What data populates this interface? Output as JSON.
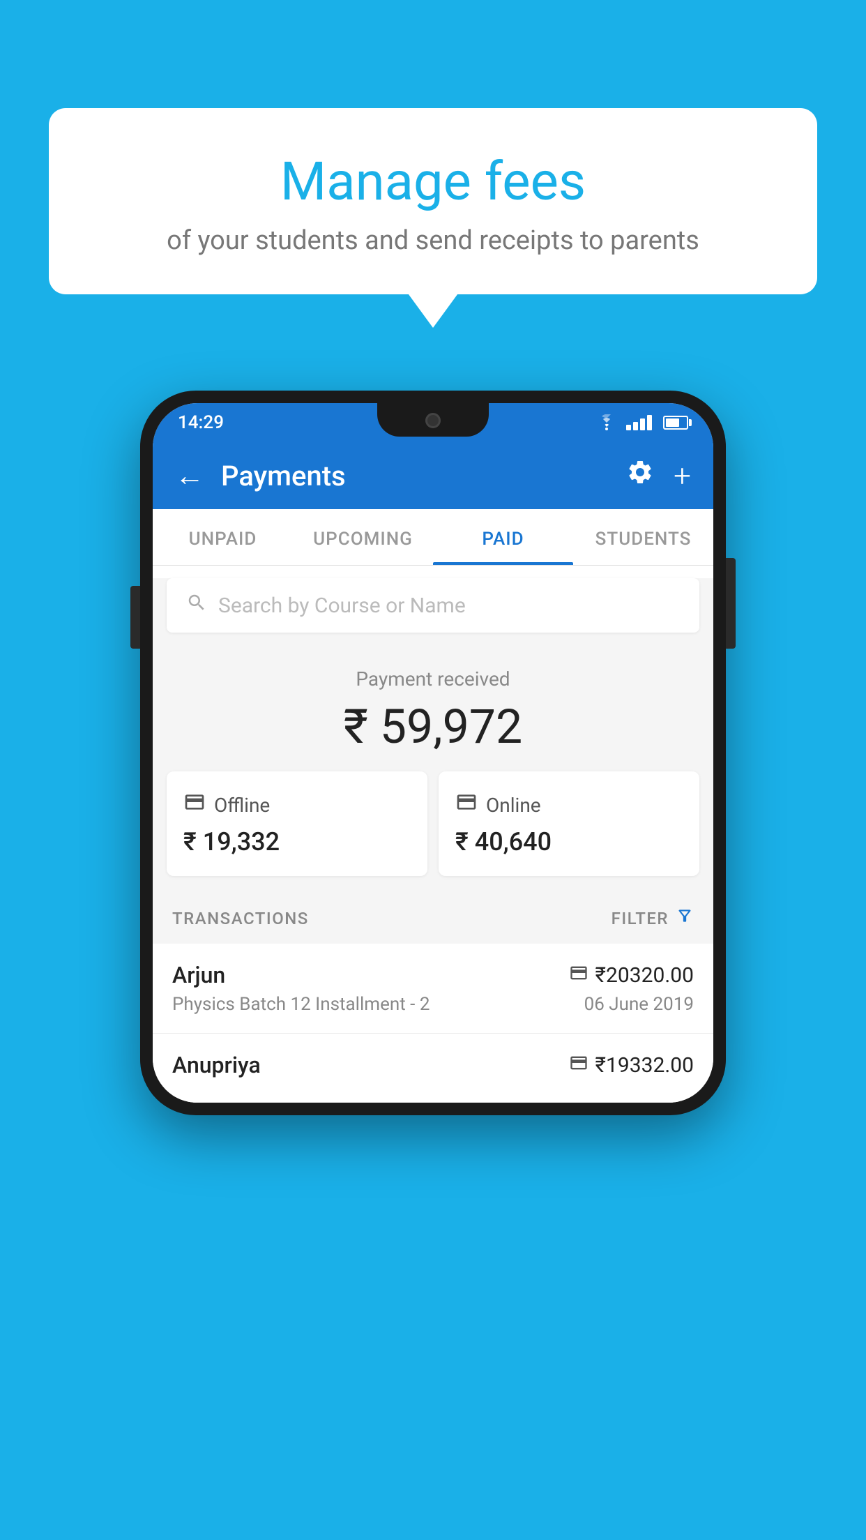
{
  "background_color": "#1ab0e8",
  "speech_bubble": {
    "title": "Manage fees",
    "subtitle": "of your students and send receipts to parents"
  },
  "status_bar": {
    "time": "14:29"
  },
  "app_bar": {
    "title": "Payments",
    "back_label": "←",
    "gear_label": "⚙",
    "plus_label": "+"
  },
  "tabs": [
    {
      "label": "UNPAID",
      "active": false
    },
    {
      "label": "UPCOMING",
      "active": false
    },
    {
      "label": "PAID",
      "active": true
    },
    {
      "label": "STUDENTS",
      "active": false
    }
  ],
  "search": {
    "placeholder": "Search by Course or Name"
  },
  "payment_summary": {
    "label": "Payment received",
    "amount": "₹ 59,972",
    "offline": {
      "label": "Offline",
      "amount": "₹ 19,332"
    },
    "online": {
      "label": "Online",
      "amount": "₹ 40,640"
    }
  },
  "transactions": {
    "header": "TRANSACTIONS",
    "filter_label": "FILTER",
    "rows": [
      {
        "name": "Arjun",
        "course": "Physics Batch 12 Installment - 2",
        "amount": "₹20320.00",
        "date": "06 June 2019",
        "type": "online"
      },
      {
        "name": "Anupriya",
        "course": "",
        "amount": "₹19332.00",
        "date": "",
        "type": "offline"
      }
    ]
  }
}
